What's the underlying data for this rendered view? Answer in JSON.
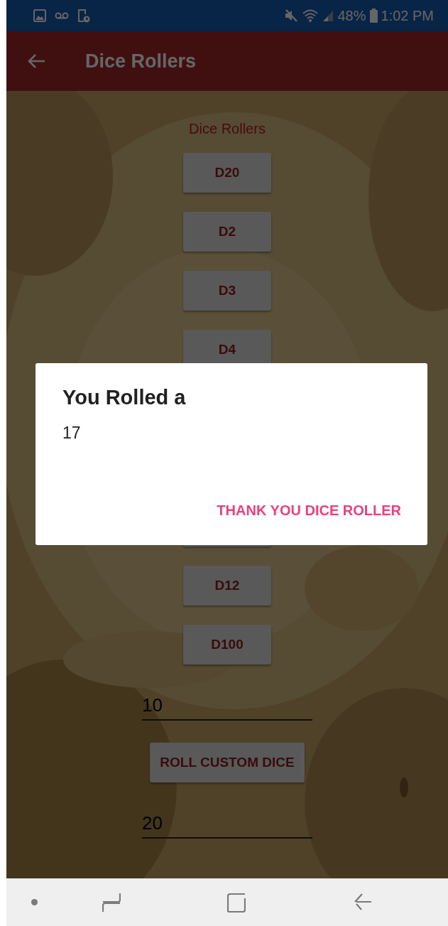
{
  "status_bar": {
    "battery": "48%",
    "time": "1:02 PM"
  },
  "app_bar": {
    "title": "Dice Rollers"
  },
  "content": {
    "heading": "Dice Rollers",
    "controls": [
      {
        "kind": "button",
        "label": "D20"
      },
      {
        "kind": "button",
        "label": "D2"
      },
      {
        "kind": "button",
        "label": "D3"
      },
      {
        "kind": "button",
        "label": "D4"
      },
      {
        "kind": "covered_button"
      },
      {
        "kind": "button",
        "label": "D12"
      },
      {
        "kind": "button",
        "label": "D100"
      },
      {
        "kind": "field",
        "value": "10"
      },
      {
        "kind": "button",
        "label": "ROLL CUSTOM DICE"
      },
      {
        "kind": "field",
        "value": "20"
      }
    ]
  },
  "dialog": {
    "title": "You Rolled a",
    "message": "17",
    "action": "THANK YOU DICE ROLLER"
  }
}
